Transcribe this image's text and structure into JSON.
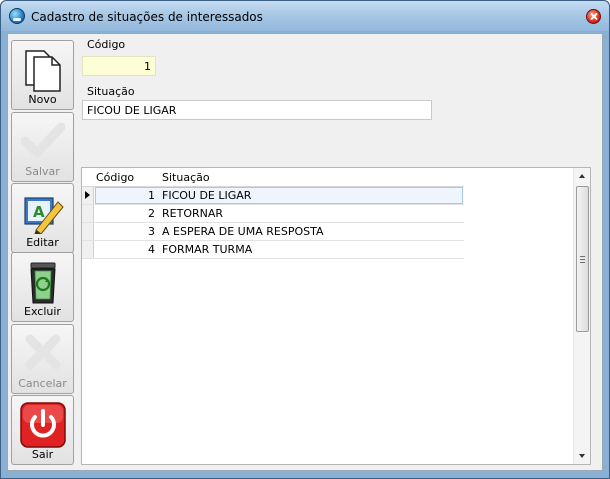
{
  "window": {
    "title": "Cadastro de situações de interessados"
  },
  "toolbar": {
    "novo": "Novo",
    "salvar": "Salvar",
    "editar": "Editar",
    "excluir": "Excluir",
    "cancelar": "Cancelar",
    "sair": "Sair"
  },
  "form": {
    "codigo_label": "Código",
    "codigo_value": "1",
    "situacao_label": "Situação",
    "situacao_value": "FICOU DE LIGAR"
  },
  "grid": {
    "columns": [
      "Código",
      "Situação"
    ],
    "rows": [
      {
        "codigo": "1",
        "situacao": "FICOU DE LIGAR"
      },
      {
        "codigo": "2",
        "situacao": "RETORNAR"
      },
      {
        "codigo": "3",
        "situacao": "A ESPERA DE UMA RESPOSTA"
      },
      {
        "codigo": "4",
        "situacao": "FORMAR TURMA"
      }
    ]
  },
  "icons": {
    "window": "app-globe-icon",
    "close": "close-icon",
    "novo": "new-document-icon",
    "salvar": "checkmark-icon",
    "editar": "edit-pencil-icon",
    "excluir": "recycle-bin-icon",
    "cancelar": "cancel-x-icon",
    "sair": "power-icon"
  }
}
